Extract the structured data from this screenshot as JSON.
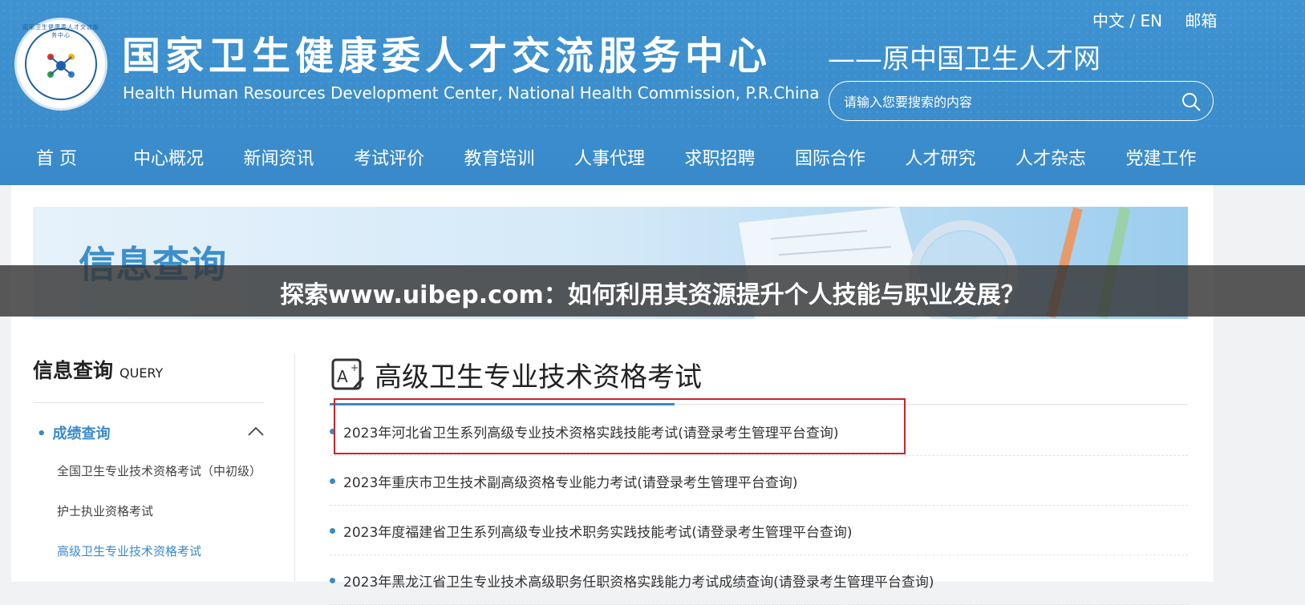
{
  "header": {
    "title_cn": "国家卫生健康委人才交流服务中心",
    "title_en": "Health Human Resources Development Center, National Health Commission, P.R.China",
    "subtitle": "——原中国卫生人才网",
    "logo_text": "国家卫生健康委人才交流服务中心",
    "top_links": {
      "lang": "中文 / EN",
      "mail": "邮箱"
    },
    "search_placeholder": "请输入您要搜索的内容",
    "nav": [
      "首 页",
      "中心概况",
      "新闻资讯",
      "考试评价",
      "教育培训",
      "人事代理",
      "求职招聘",
      "国际合作",
      "人才研究",
      "人才杂志",
      "党建工作"
    ]
  },
  "banner": {
    "title": "信息查询"
  },
  "sidebar": {
    "title": "信息查询",
    "title_en": "QUERY",
    "category": "成绩查询",
    "items": [
      "全国卫生专业技术资格考试（中初级）",
      "护士执业资格考试",
      "高级卫生专业技术资格考试"
    ],
    "active_index": 2
  },
  "main": {
    "title": "高级卫生专业技术资格考试",
    "items": [
      "2023年河北省卫生系列高级专业技术资格实践技能考试(请登录考生管理平台查询)",
      "2023年重庆市卫生技术副高级资格专业能力考试(请登录考生管理平台查询)",
      "2023年度福建省卫生系列高级专业技术职务实践技能考试(请登录考生管理平台查询)",
      "2023年黑龙江省卫生专业技术高级职务任职资格实践能力考试成绩查询(请登录考生管理平台查询)"
    ]
  },
  "overlay": {
    "caption": "探索www.uibep.com：如何利用其资源提升个人技能与职业发展？"
  },
  "colors": {
    "header_blue": "#3b8dcc",
    "accent": "#3a8acb",
    "highlight_red": "#c9252b"
  },
  "icons": [
    "logo-emblem",
    "search-icon",
    "chevron-up-icon",
    "exam-icon"
  ]
}
